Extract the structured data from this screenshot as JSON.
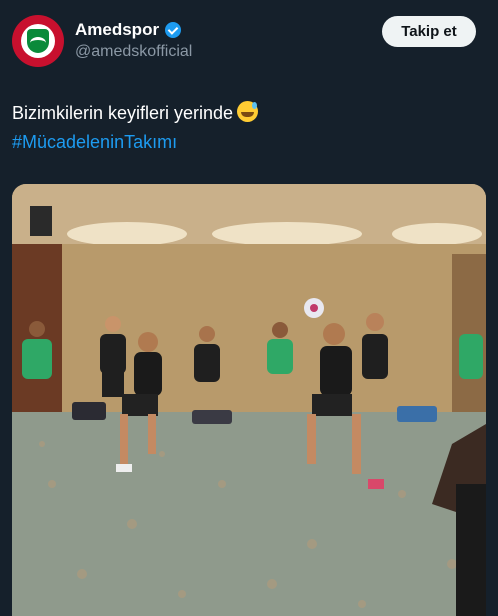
{
  "tweet": {
    "author": {
      "name": "Amedspor",
      "handle": "@amedskofficial",
      "verified": true,
      "avatar_icon": "amedspor-crest-icon"
    },
    "follow_label": "Takip et",
    "text": "Bizimkilerin keyifleri yerinde",
    "emoji": "grinning-face-with-sweat-icon",
    "hashtag": "#MücadeleninTakımı"
  },
  "colors": {
    "background": "#15202b",
    "accent": "#1d9bf0",
    "follow_button": "#eff3f4",
    "avatar": "#c8102e"
  }
}
